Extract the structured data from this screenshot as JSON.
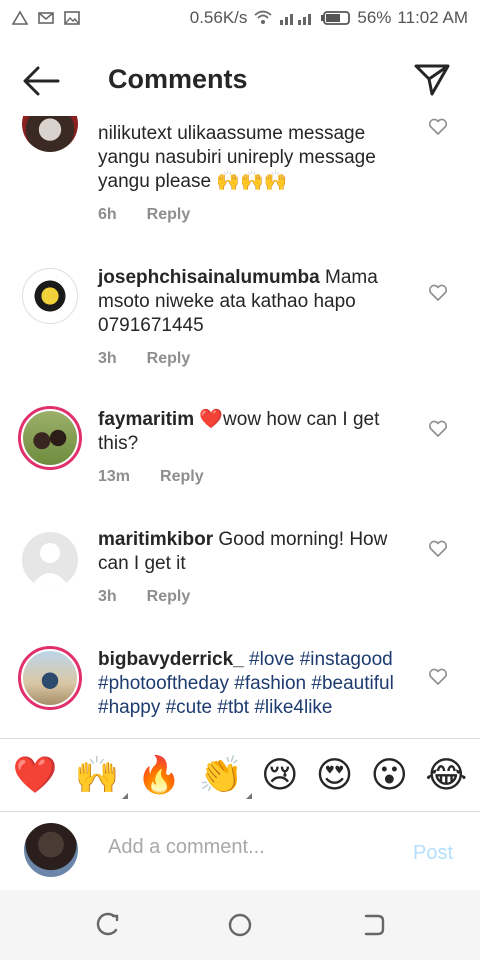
{
  "status_bar": {
    "speed": "0.56K/s",
    "battery": "56%",
    "time": "11:02 AM"
  },
  "header": {
    "title": "Comments"
  },
  "comments": [
    {
      "username": "",
      "text": "nilikutext ulikaassume message yangu nasubiri unireply message yangu please 🙌🙌🙌",
      "time": "6h",
      "reply": "Reply"
    },
    {
      "username": "josephchisainalumumba",
      "text": " Mama msoto niweke ata kathao hapo 0791671445",
      "time": "3h",
      "reply": "Reply"
    },
    {
      "username": "faymaritim",
      "text": " ❤️wow how can I get this?",
      "time": "13m",
      "reply": "Reply"
    },
    {
      "username": "maritimkibor",
      "text": " Good morning! How can I get it",
      "time": "3h",
      "reply": "Reply"
    },
    {
      "username": "bigbavyderrick_",
      "tags": "#love #instagood #photooftheday #fashion #beautiful #happy #cute #tbt #like4like"
    }
  ],
  "emoji_bar": {
    "emojis": [
      "❤️",
      "🙌",
      "🔥",
      "👏",
      "😢",
      "😍",
      "😮",
      "😂"
    ]
  },
  "comment_input": {
    "placeholder": "Add a comment...",
    "post_label": "Post"
  }
}
